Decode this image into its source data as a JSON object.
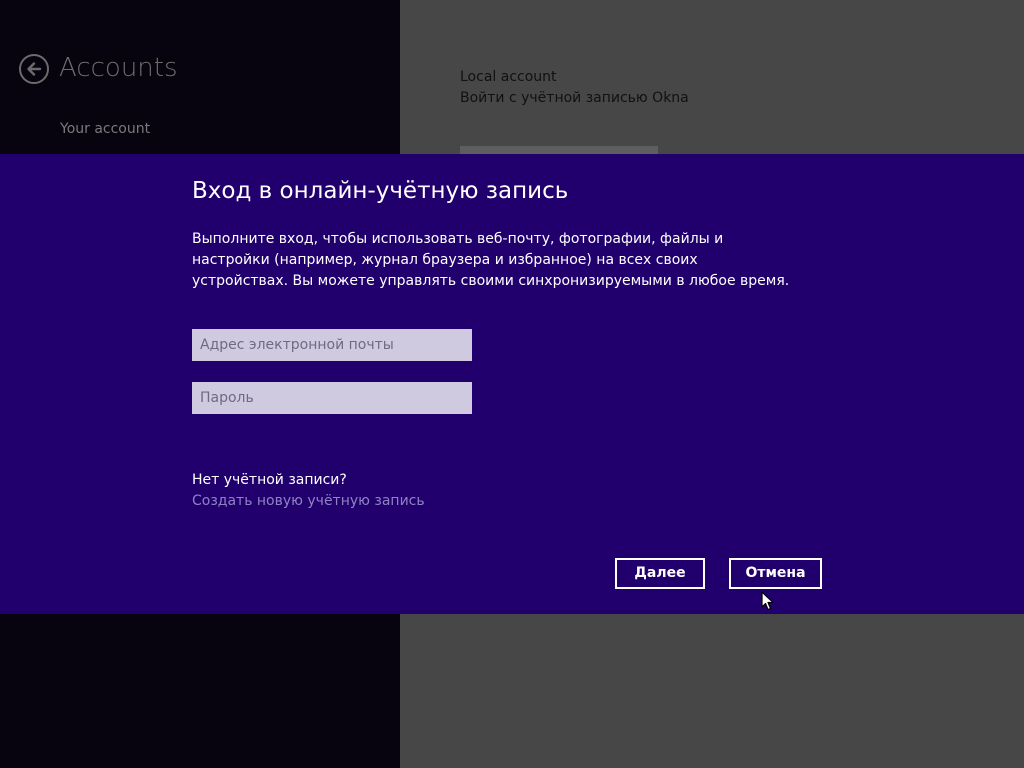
{
  "header": {
    "title": "Accounts",
    "back_icon": "back-arrow-icon"
  },
  "sidebar": {
    "items": [
      {
        "label": "Your account"
      }
    ]
  },
  "main": {
    "account_type": "Local account",
    "account_sub": "Войти с учётной записью Okna"
  },
  "dialog": {
    "title": "Вход в онлайн-учётную запись",
    "description": "Выполните вход, чтобы использовать веб-почту, фотографии, файлы и настройки (например, журнал браузера и избранное) на всех своих устройствах. Вы можете управлять своими синхронизируемыми в любое время.",
    "email": {
      "placeholder": "Адрес электронной почты",
      "value": ""
    },
    "password": {
      "placeholder": "Пароль",
      "value": ""
    },
    "no_account": "Нет учётной записи?",
    "create_account": "Создать новую учётную запись",
    "next_label": "Далее",
    "cancel_label": "Отмена"
  },
  "colors": {
    "dialog_bg": "#21006e",
    "left_pane_bg": "#07030f",
    "right_pane_bg": "#474747",
    "link": "#8f82c4",
    "input_bg": "#cfcae0"
  }
}
